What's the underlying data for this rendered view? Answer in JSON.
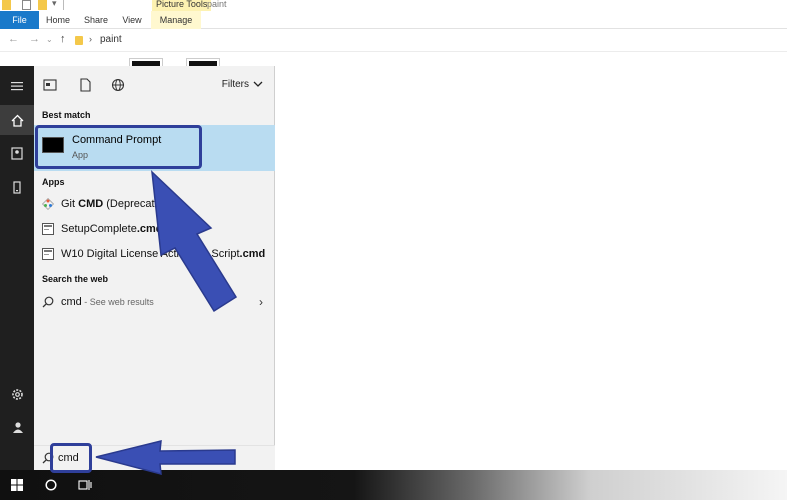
{
  "explorer": {
    "ribbon_context_label": "Picture Tools",
    "window_title": "paint",
    "tabs": [
      {
        "label": "File"
      },
      {
        "label": "Home"
      },
      {
        "label": "Share"
      },
      {
        "label": "View"
      },
      {
        "label": "Manage"
      }
    ],
    "address_path": "paint"
  },
  "search_panel": {
    "filters_label": "Filters",
    "best_match_heading": "Best match",
    "best_match": {
      "name": "Command Prompt",
      "type": "App"
    },
    "apps_heading": "Apps",
    "apps": [
      {
        "prefix": "Git ",
        "bold": "CMD",
        "suffix": " (Deprecated)",
        "icon": "git-icon"
      },
      {
        "prefix": "SetupComplete",
        "bold": ".cmd",
        "suffix": "",
        "icon": "script-file-icon"
      },
      {
        "prefix": "W10 Digital License Activation Script",
        "bold": ".cmd",
        "suffix": "",
        "icon": "script-file-icon"
      }
    ],
    "web_heading": "Search the web",
    "web_query": "cmd",
    "web_suffix": " - See web results"
  },
  "search_box": {
    "value": "cmd"
  },
  "colors": {
    "accent": "#1979ca",
    "highlight": "#b9dcf1",
    "callout": "#3a4fb4",
    "rail": "#1f1f1f"
  }
}
